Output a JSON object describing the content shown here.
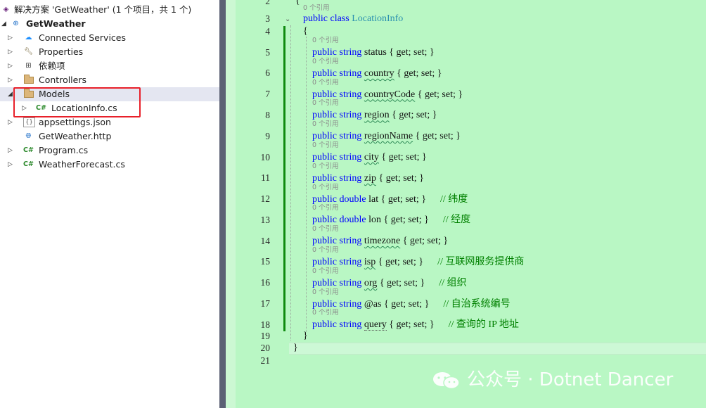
{
  "solution_explorer": {
    "solution_label": "解决方案 'GetWeather' (1 个项目，共 1 个)",
    "project_name": "GetWeather",
    "items": [
      {
        "label": "Connected Services",
        "icon": "connected-services-icon"
      },
      {
        "label": "Properties",
        "icon": "wrench-icon"
      },
      {
        "label": "依赖项",
        "icon": "dependencies-icon"
      },
      {
        "label": "Controllers",
        "icon": "folder-icon"
      },
      {
        "label": "Models",
        "icon": "folder-icon",
        "selected": true
      },
      {
        "label": "LocationInfo.cs",
        "icon": "csharp-file-icon"
      },
      {
        "label": "appsettings.json",
        "icon": "json-file-icon"
      },
      {
        "label": "GetWeather.http",
        "icon": "http-file-icon"
      },
      {
        "label": "Program.cs",
        "icon": "csharp-file-icon"
      },
      {
        "label": "WeatherForecast.cs",
        "icon": "csharp-file-icon"
      }
    ],
    "cs_glyph": "C#",
    "json_glyph": "{}",
    "highlight_color": "#e8202a"
  },
  "editor": {
    "background": "#b9f7c4",
    "references_lens": "0 个引用",
    "line_numbers": [
      "2",
      "3",
      "4",
      "5",
      "6",
      "7",
      "8",
      "9",
      "10",
      "11",
      "12",
      "13",
      "14",
      "15",
      "16",
      "17",
      "18",
      "19",
      "20",
      "21"
    ],
    "class_line": {
      "kw": "public class",
      "name": "LocationInfo"
    },
    "open_brace": "{",
    "close_brace": "}",
    "accessor": "{ get; set; }",
    "properties": [
      {
        "kw": "public string",
        "name": "status",
        "comment": ""
      },
      {
        "kw": "public string",
        "name": "country",
        "comment": ""
      },
      {
        "kw": "public string",
        "name": "countryCode",
        "comment": ""
      },
      {
        "kw": "public string",
        "name": "region",
        "comment": ""
      },
      {
        "kw": "public string",
        "name": "regionName",
        "comment": ""
      },
      {
        "kw": "public string",
        "name": "city",
        "comment": ""
      },
      {
        "kw": "public string",
        "name": "zip",
        "comment": ""
      },
      {
        "kw": "public double",
        "name": "lat",
        "comment": "// 纬度"
      },
      {
        "kw": "public double",
        "name": "lon",
        "comment": "// 经度"
      },
      {
        "kw": "public string",
        "name": "timezone",
        "comment": ""
      },
      {
        "kw": "public string",
        "name": "isp",
        "comment": "// 互联网服务提供商"
      },
      {
        "kw": "public string",
        "name": "org",
        "comment": "// 组织"
      },
      {
        "kw": "public string",
        "name": "@as",
        "comment": "// 自治系统编号"
      },
      {
        "kw": "public string",
        "name": "query",
        "comment": "// 查询的 IP 地址"
      }
    ]
  },
  "watermark": {
    "text": "公众号 · Dotnet Dancer"
  }
}
